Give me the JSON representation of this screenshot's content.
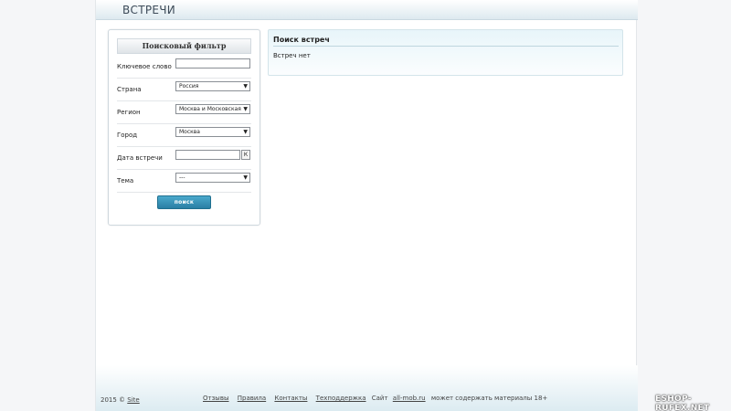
{
  "header": {
    "title": "ВСТРЕЧИ"
  },
  "filter": {
    "title": "Поисковый фильтр",
    "keyword_label": "Ключевое слово",
    "keyword_value": "",
    "country_label": "Страна",
    "country_value": "Россия",
    "region_label": "Регион",
    "region_value": "Москва и Московская",
    "city_label": "Город",
    "city_value": "Москва",
    "date_label": "Дата встречи",
    "date_value": "",
    "date_button": "К",
    "topic_label": "Тема",
    "topic_value": "---",
    "search_button": "поиск",
    "select_arrow": "▼"
  },
  "results": {
    "title": "Поиск встреч",
    "empty_text": "Встреч нет"
  },
  "footer": {
    "copyright_year": "2015 ©",
    "copyright_link": "Site",
    "links": [
      "Отзывы",
      "Правила",
      "Контакты",
      "Техподдержка"
    ],
    "site_prefix": "Сайт",
    "site_link": "all-mob.ru",
    "site_suffix": "может содержать материалы 18+"
  },
  "watermark": "ESHOP-RUFEX.NET"
}
